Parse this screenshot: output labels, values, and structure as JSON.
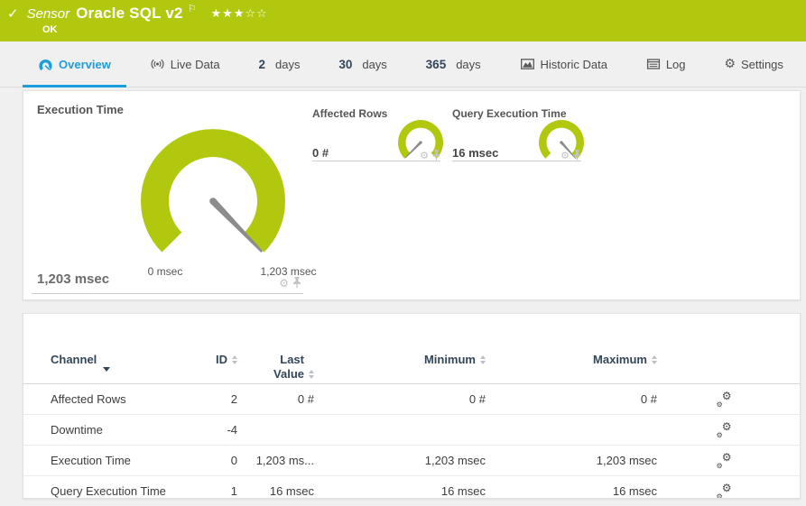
{
  "header": {
    "status_icon": "✓",
    "kind_label": "Sensor",
    "title": "Oracle SQL v2",
    "flag_icon": "⚐",
    "stars_filled": "★★★",
    "stars_empty": "☆☆",
    "status_text": "OK"
  },
  "tabs": {
    "items": [
      {
        "label": "Overview",
        "icon": "gauge-icon",
        "active": true
      },
      {
        "label": "Live Data",
        "icon": "live-data-icon",
        "active": false
      },
      {
        "number": "2",
        "label": "days",
        "active": false
      },
      {
        "number": "30",
        "label": "days",
        "active": false
      },
      {
        "number": "365",
        "label": "days",
        "active": false
      },
      {
        "label": "Historic Data",
        "icon": "historic-data-icon",
        "active": false
      },
      {
        "label": "Log",
        "icon": "log-icon",
        "active": false
      },
      {
        "label": "Settings",
        "icon": "settings-icon",
        "active": false
      }
    ]
  },
  "gauges": {
    "primary": {
      "title": "Execution Time",
      "value": "1,203 msec",
      "min_label": "0 msec",
      "max_label": "1,203 msec",
      "needle_fraction": 1
    },
    "minis": [
      {
        "title": "Affected Rows",
        "value": "0 #",
        "needle_fraction": 0
      },
      {
        "title": "Query Execution Time",
        "value": "16 msec",
        "needle_fraction": 1
      }
    ]
  },
  "channel_table": {
    "headers": {
      "channel": "Channel",
      "id": "ID",
      "last_value_line1": "Last",
      "last_value_line2": "Value",
      "minimum": "Minimum",
      "maximum": "Maximum"
    },
    "rows": [
      {
        "channel": "Affected Rows",
        "id": "2",
        "last_value": "0 #",
        "minimum": "0 #",
        "maximum": "0 #"
      },
      {
        "channel": "Downtime",
        "id": "-4",
        "last_value": "",
        "minimum": "",
        "maximum": ""
      },
      {
        "channel": "Execution Time",
        "id": "0",
        "last_value": "1,203 ms...",
        "minimum": "1,203 msec",
        "maximum": "1,203 msec"
      },
      {
        "channel": "Query Execution Time",
        "id": "1",
        "last_value": "16 msec",
        "minimum": "16 msec",
        "maximum": "16 msec"
      }
    ]
  },
  "colors": {
    "brand_green": "#b2c80f",
    "accent_blue": "#1d9ed9",
    "header_navy": "#32465a",
    "needle_gray": "#8c8c8c"
  }
}
